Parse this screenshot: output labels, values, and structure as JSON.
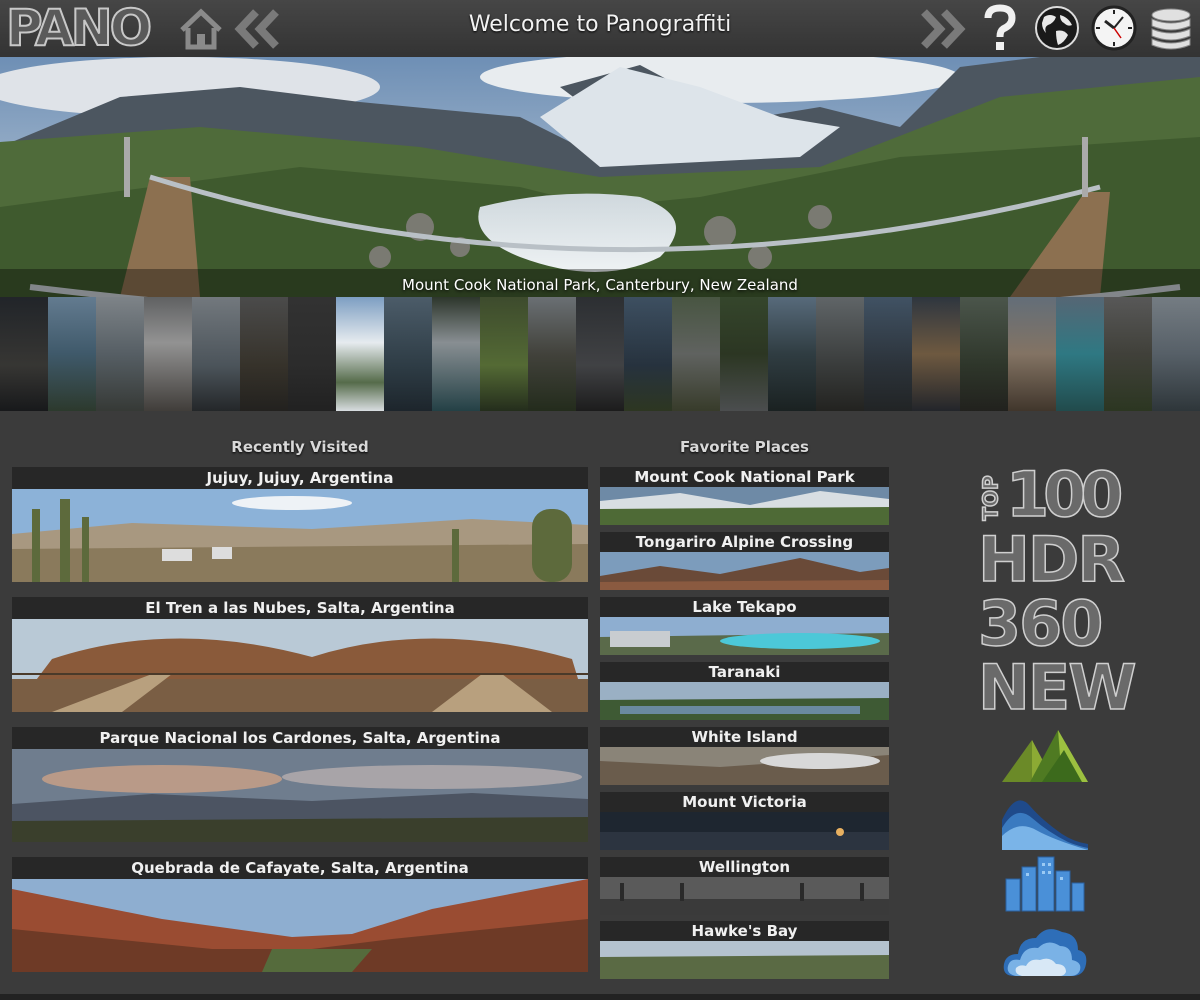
{
  "header": {
    "logo": "PANO",
    "title": "Welcome to Panograffiti"
  },
  "hero": {
    "caption": "Mount Cook National Park, Canterbury, New Zealand"
  },
  "sections": {
    "recent_title": "Recently Visited",
    "favorites_title": "Favorite Places"
  },
  "recent": [
    {
      "label": "Jujuy, Jujuy, Argentina"
    },
    {
      "label": "El Tren a las Nubes, Salta, Argentina"
    },
    {
      "label": "Parque Nacional los Cardones, Salta, Argentina"
    },
    {
      "label": "Quebrada de Cafayate, Salta, Argentina"
    }
  ],
  "favorites": [
    {
      "label": "Mount Cook National Park"
    },
    {
      "label": "Tongariro Alpine Crossing"
    },
    {
      "label": "Lake Tekapo"
    },
    {
      "label": "Taranaki"
    },
    {
      "label": "White Island"
    },
    {
      "label": "Mount Victoria"
    },
    {
      "label": "Wellington"
    },
    {
      "label": "Hawke's Bay"
    }
  ],
  "categories": {
    "top100": {
      "line1": "TOP",
      "line2": "100"
    },
    "hdr": "HDR",
    "p360": "360",
    "new": "NEW"
  },
  "icons": {
    "home": "home-icon",
    "back": "double-chevron-left-icon",
    "forward": "double-chevron-right-icon",
    "help": "question-mark-icon",
    "globe": "globe-icon",
    "clock": "clock-icon",
    "database": "database-icon",
    "mountains": "mountains-icon",
    "waves": "waves-icon",
    "city": "city-icon",
    "cloud": "cloud-icon"
  },
  "colors": {
    "background": "#3b3b3b",
    "topbar": "#404040",
    "label_bg": "#2a2a2a"
  }
}
